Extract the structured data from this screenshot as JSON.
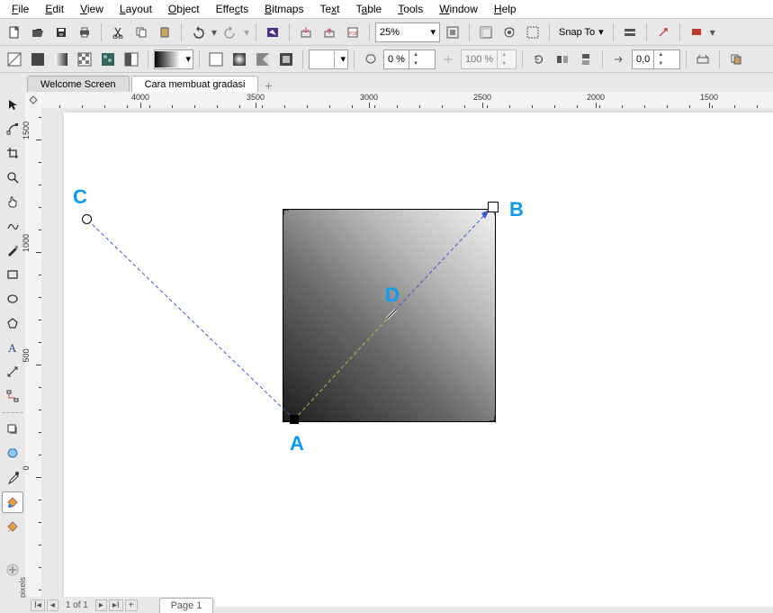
{
  "menu": {
    "file": "File",
    "edit": "Edit",
    "view": "View",
    "layout": "Layout",
    "object": "Object",
    "effects": "Effects",
    "bitmaps": "Bitmaps",
    "text": "Text",
    "table": "Table",
    "tools": "Tools",
    "window": "Window",
    "help": "Help"
  },
  "toolbar1": {
    "zoom": "25%",
    "snapTo": "Snap To"
  },
  "toolbar2": {
    "transparencyPercent": "0 %",
    "mergePercent": "100 %",
    "offset": "0,0"
  },
  "tabs": {
    "welcome": "Welcome Screen",
    "doc1": "Cara membuat gradasi"
  },
  "rulerH": [
    {
      "pos": 110,
      "label": "4000"
    },
    {
      "pos": 238,
      "label": "3500"
    },
    {
      "pos": 364,
      "label": "3000"
    },
    {
      "pos": 490,
      "label": "2500"
    },
    {
      "pos": 616,
      "label": "2000"
    },
    {
      "pos": 742,
      "label": "1500"
    }
  ],
  "rulerV": [
    {
      "pos": 35,
      "label": "1500"
    },
    {
      "pos": 160,
      "label": "1000"
    },
    {
      "pos": 285,
      "label": "500"
    },
    {
      "pos": 410,
      "label": "0"
    }
  ],
  "labels": {
    "A": "A",
    "B": "B",
    "C": "C",
    "D": "D"
  },
  "status": {
    "pageNav": "1 of 1",
    "pageName": "Page 1"
  },
  "rulerUnit": "pixels"
}
